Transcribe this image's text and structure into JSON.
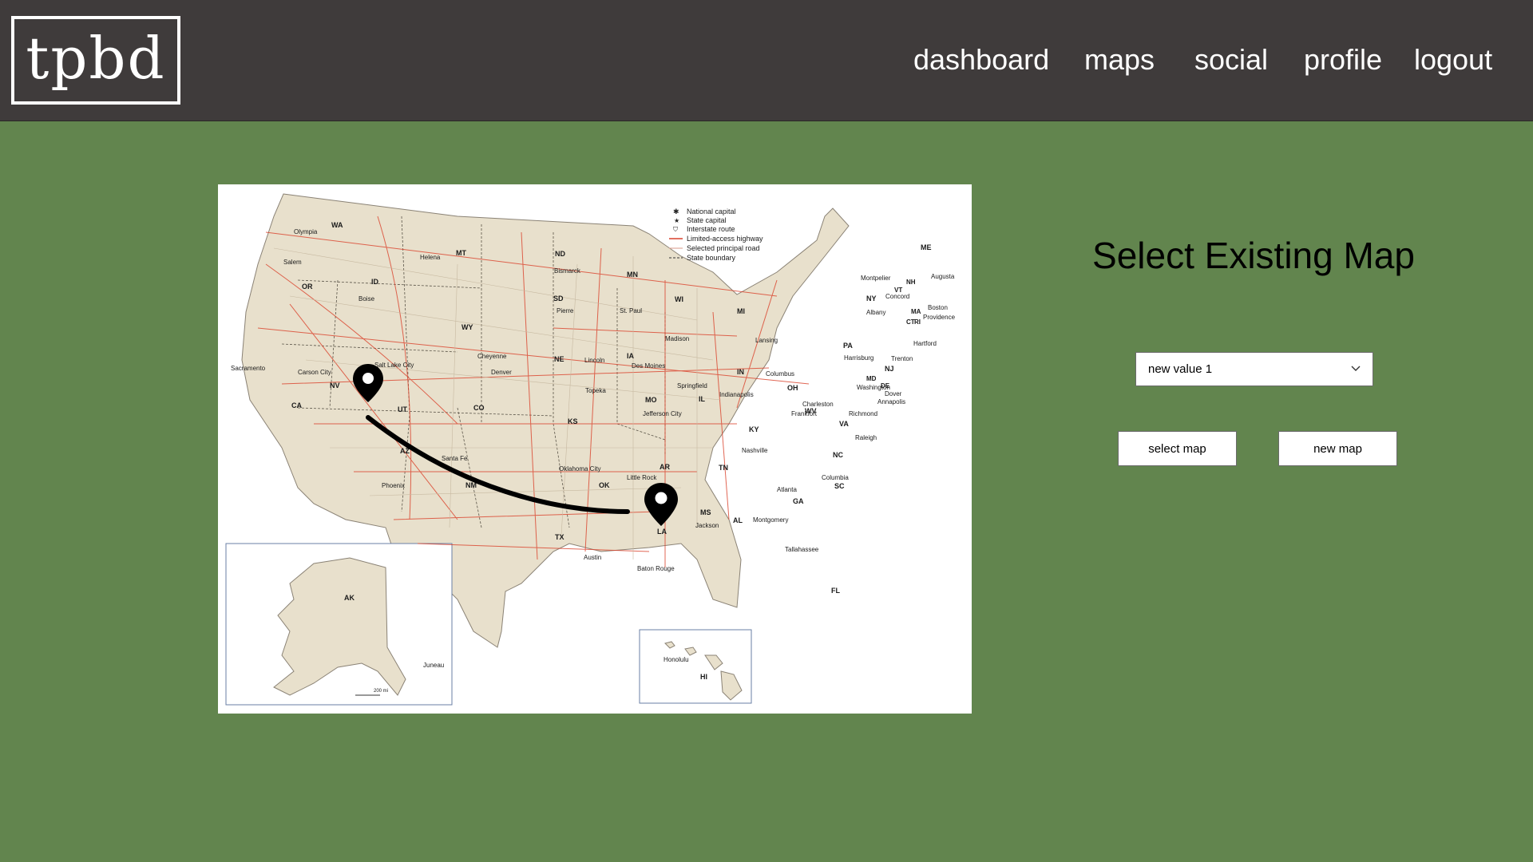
{
  "app": {
    "logo_text": "tpbd"
  },
  "nav": {
    "items": [
      {
        "label": "dashboard"
      },
      {
        "label": "maps"
      },
      {
        "label": "social"
      },
      {
        "label": "profile"
      },
      {
        "label": "logout"
      }
    ]
  },
  "map": {
    "legend": [
      "National capital",
      "State capital",
      "Interstate route",
      "Limited-access highway",
      "Selected principal road",
      "State boundary"
    ],
    "state_labels": [
      "WA",
      "OR",
      "ID",
      "MT",
      "ND",
      "MN",
      "WI",
      "MI",
      "NY",
      "ME",
      "CA",
      "NV",
      "UT",
      "WY",
      "SD",
      "NE",
      "IA",
      "IL",
      "IN",
      "OH",
      "PA",
      "NJ",
      "CO",
      "KS",
      "MO",
      "KY",
      "WV",
      "VA",
      "AZ",
      "NM",
      "OK",
      "AR",
      "TN",
      "NC",
      "SC",
      "TX",
      "LA",
      "MS",
      "AL",
      "GA",
      "FL",
      "AK",
      "HI",
      "DE",
      "MD",
      "CT",
      "RI",
      "MA",
      "VT",
      "NH"
    ],
    "city_labels": [
      "Olympia",
      "Salem",
      "Boise",
      "Helena",
      "Bismarck",
      "Pierre",
      "St. Paul",
      "Madison",
      "Lansing",
      "Albany",
      "Augusta",
      "Montpelier",
      "Concord",
      "Boston",
      "Providence",
      "Hartford",
      "Harrisburg",
      "Trenton",
      "Dover",
      "Annapolis",
      "Washington",
      "Richmond",
      "Columbus",
      "Indianapolis",
      "Springfield",
      "Frankfort",
      "Charleston",
      "Raleigh",
      "Columbia",
      "Atlanta",
      "Nashville",
      "Montgomery",
      "Tallahassee",
      "Jackson",
      "Baton Rouge",
      "Little Rock",
      "Oklahoma City",
      "Topeka",
      "Lincoln",
      "Des Moines",
      "Jefferson City",
      "Denver",
      "Cheyenne",
      "Santa Fe",
      "Phoenix",
      "Austin",
      "Carson City",
      "Salt Lake City",
      "Sacramento",
      "Honolulu",
      "Juneau"
    ],
    "scale_label": "200 mi",
    "route": {
      "from": "Salt Lake City area",
      "to": "Little Rock area"
    }
  },
  "sidebar": {
    "title": "Select Existing Map",
    "dropdown_value": "new value 1",
    "select_button": "select map",
    "new_button": "new map"
  },
  "colors": {
    "background": "#62854e",
    "topbar": "#3f3b3b",
    "land": "#e8e0cc",
    "roads": "#d9412b"
  }
}
